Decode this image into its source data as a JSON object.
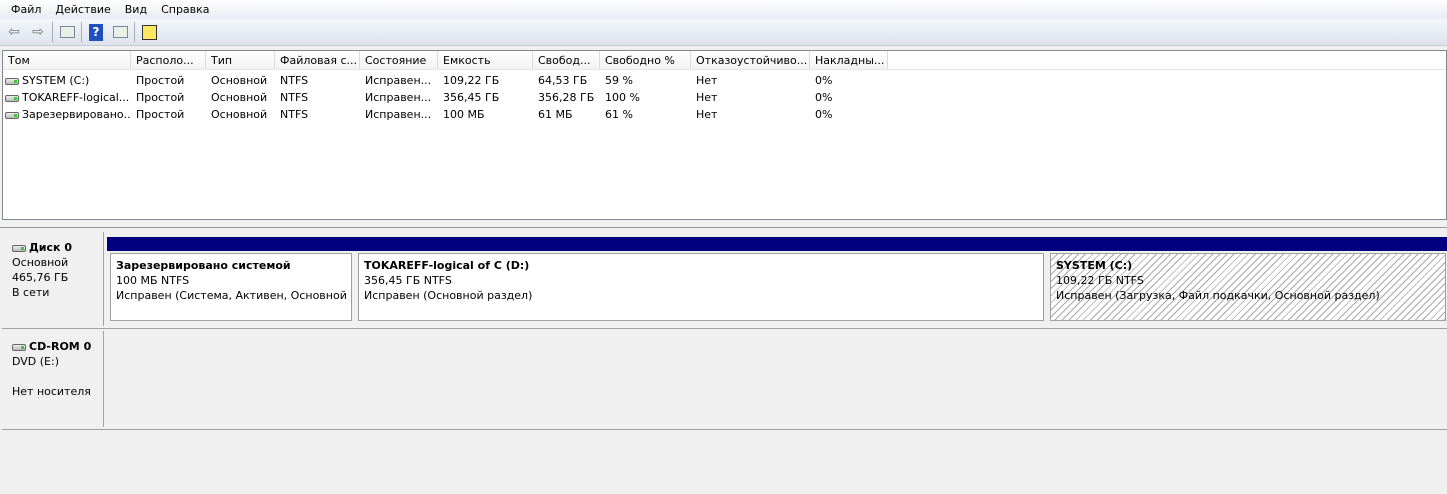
{
  "menu": [
    "Файл",
    "Действие",
    "Вид",
    "Справка"
  ],
  "columns": [
    "Том",
    "Располо...",
    "Тип",
    "Файловая с...",
    "Состояние",
    "Емкость",
    "Свобод...",
    "Свободно %",
    "Отказоустойчиво...",
    "Накладны..."
  ],
  "volumes": [
    [
      "SYSTEM (C:)",
      "Простой",
      "Основной",
      "NTFS",
      "Исправен...",
      "109,22 ГБ",
      "64,53 ГБ",
      "59 %",
      "Нет",
      "0%"
    ],
    [
      "TOKAREFF-logical...",
      "Простой",
      "Основной",
      "NTFS",
      "Исправен...",
      "356,45 ГБ",
      "356,28 ГБ",
      "100 %",
      "Нет",
      "0%"
    ],
    [
      "Зарезервировано...",
      "Простой",
      "Основной",
      "NTFS",
      "Исправен...",
      "100 МБ",
      "61 МБ",
      "61 %",
      "Нет",
      "0%"
    ]
  ],
  "disk0": {
    "name": "Диск 0",
    "type": "Основной",
    "size": "465,76 ГБ",
    "status": "В сети",
    "partitions": [
      {
        "title": "Зарезервировано системой",
        "size": "100 МБ NTFS",
        "status": "Исправен (Система, Активен, Основной раздел)"
      },
      {
        "title": "TOKAREFF-logical of C  (D:)",
        "size": "356,45 ГБ NTFS",
        "status": "Исправен (Основной раздел)"
      },
      {
        "title": "SYSTEM  (C:)",
        "size": "109,22 ГБ NTFS",
        "status": "Исправен (Загрузка, Файл подкачки, Основной раздел)"
      }
    ]
  },
  "cdrom": {
    "name": "CD-ROM 0",
    "drive": "DVD (E:)",
    "status": "Нет носителя"
  },
  "colors": {
    "partition_bar": "#000080"
  }
}
